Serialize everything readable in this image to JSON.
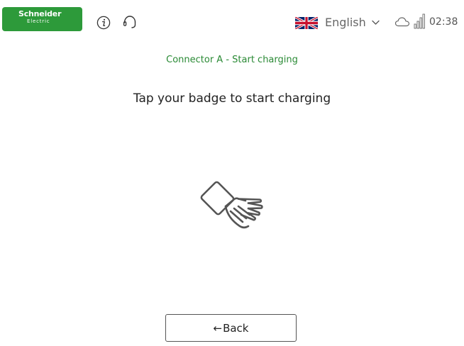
{
  "header": {
    "logo": {
      "name": "Schneider",
      "sub": "Electric",
      "color": "#2d9a3a"
    },
    "icons": [
      "info-icon",
      "help-headset-icon"
    ],
    "language": {
      "selected": "English",
      "flag": "uk-flag-icon"
    },
    "status_icons": [
      "cloud-icon",
      "signal-icon"
    ],
    "time": "02:38"
  },
  "main": {
    "subtitle": "Connector A - Start charging",
    "title": "Tap your badge to start charging",
    "illustration": "hand-badge-icon"
  },
  "footer": {
    "back_arrow": "←",
    "back_label": "Back"
  },
  "colors": {
    "accent": "#2a8a35",
    "text": "#222222",
    "muted": "#666666"
  }
}
